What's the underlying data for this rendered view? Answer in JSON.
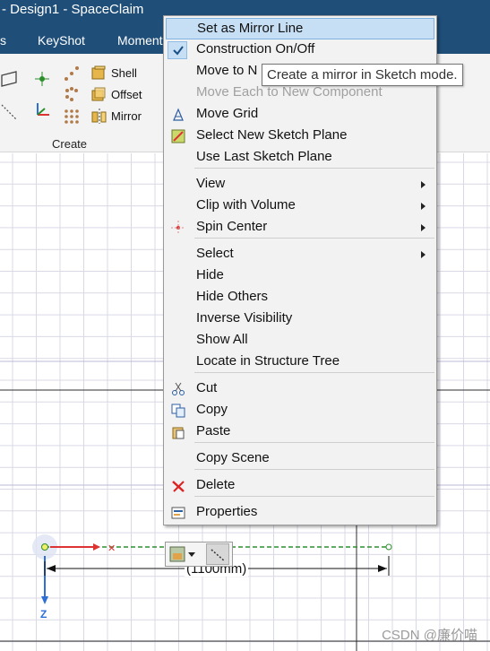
{
  "window": {
    "title": "- Design1 - SpaceClaim"
  },
  "tabs": {
    "left_fragment": "s",
    "keyshot": "KeyShot",
    "moment": "Moment"
  },
  "ribbon": {
    "shell_label": "Shell",
    "offset_label": "Offset",
    "mirror_label": "Mirror",
    "group_label": "Create"
  },
  "menu": {
    "items": [
      {
        "label": "Set as Mirror Line",
        "icon": "none",
        "state": "highlighted"
      },
      {
        "label": "Construction On/Off",
        "icon": "check-icon",
        "state": "checked"
      },
      {
        "label": "Move to N",
        "icon": "none",
        "state": "normal"
      },
      {
        "label": "Move Each to New Component",
        "icon": "none",
        "state": "disabled"
      },
      {
        "label": "Move Grid",
        "icon": "move-grid-icon",
        "state": "normal"
      },
      {
        "label": "Select New Sketch Plane",
        "icon": "sketch-plane-icon",
        "state": "normal"
      },
      {
        "label": "Use Last Sketch Plane",
        "icon": "none",
        "state": "normal"
      },
      {
        "label": "View",
        "icon": "none",
        "state": "submenu"
      },
      {
        "label": "Clip with Volume",
        "icon": "none",
        "state": "submenu"
      },
      {
        "label": "Spin Center",
        "icon": "spin-center-icon",
        "state": "submenu"
      },
      {
        "label": "Select",
        "icon": "none",
        "state": "submenu"
      },
      {
        "label": "Hide",
        "icon": "none",
        "state": "normal"
      },
      {
        "label": "Hide Others",
        "icon": "none",
        "state": "normal"
      },
      {
        "label": "Inverse Visibility",
        "icon": "none",
        "state": "normal"
      },
      {
        "label": "Show All",
        "icon": "none",
        "state": "normal"
      },
      {
        "label": "Locate in Structure Tree",
        "icon": "none",
        "state": "normal"
      },
      {
        "label": "Cut",
        "icon": "scissors-icon",
        "state": "normal"
      },
      {
        "label": "Copy",
        "icon": "copy-icon",
        "state": "normal"
      },
      {
        "label": "Paste",
        "icon": "paste-icon",
        "state": "normal"
      },
      {
        "label": "Copy Scene",
        "icon": "none",
        "state": "normal"
      },
      {
        "label": "Delete",
        "icon": "delete-x-icon",
        "state": "normal"
      },
      {
        "label": "Properties",
        "icon": "properties-icon",
        "state": "normal"
      }
    ]
  },
  "tooltip": {
    "text": "Create a mirror in Sketch mode."
  },
  "sketch": {
    "dimension_text": "(1100mm)",
    "axis_z": "Z"
  },
  "watermark": "CSDN @廉价喵",
  "colors": {
    "titlebar": "#1f4e79",
    "highlight": "#c6dff5",
    "grid": "#d9d9e6",
    "sketch_green": "#2f8f2f"
  }
}
